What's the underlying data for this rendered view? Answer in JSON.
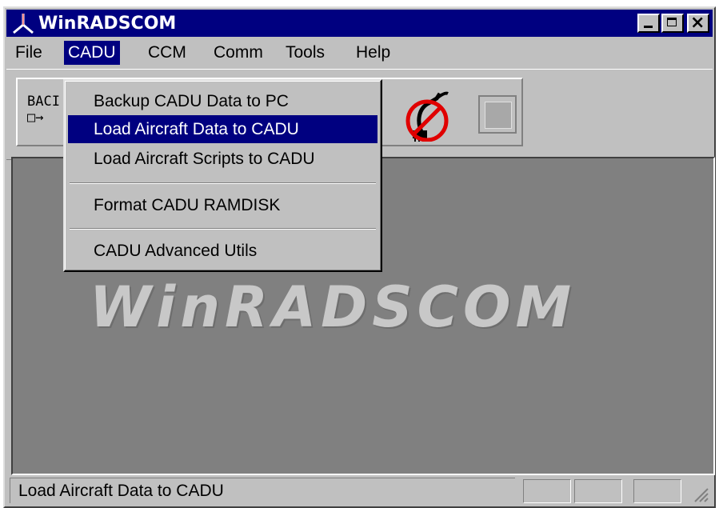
{
  "window": {
    "title": "WinRADSCOM",
    "icon": "app-logo-icon"
  },
  "title_buttons": {
    "minimize_icon": "minimize-icon",
    "maximize_icon": "maximize-icon",
    "close_icon": "close-icon"
  },
  "menubar": {
    "items": [
      {
        "label": "File",
        "mnemonic": "F"
      },
      {
        "label": "CADU",
        "mnemonic": "C"
      },
      {
        "label": "CCM",
        "mnemonic": "C"
      },
      {
        "label": "Comm",
        "mnemonic": "m"
      },
      {
        "label": "Tools",
        "mnemonic": "T"
      },
      {
        "label": "Help",
        "mnemonic": "H"
      }
    ],
    "active": "CADU"
  },
  "toolbar": {
    "backup_label": "BACI",
    "backup_glyph": "□→",
    "comm_icon": "no-connection-icon",
    "disabled_icon": "disabled-stop-icon"
  },
  "dropdown": {
    "items": [
      {
        "label": "Backup CADU Data to PC",
        "mnemonic": "B"
      },
      {
        "label": "Load Aircraft Data to CADU",
        "mnemonic": "D",
        "selected": true
      },
      {
        "label": "Load Aircraft Scripts to CADU",
        "mnemonic": "S"
      },
      {
        "label": "Format CADU RAMDISK",
        "mnemonic": "F"
      },
      {
        "label": "CADU Advanced Utils",
        "mnemonic": "C"
      }
    ]
  },
  "workspace": {
    "watermark": "WinRADSCOM"
  },
  "statusbar": {
    "text": "Load Aircraft Data to CADU"
  },
  "colors": {
    "titlebar": "#000080",
    "face": "#c0c0c0",
    "workspace": "#808080",
    "highlight": "#000080"
  }
}
